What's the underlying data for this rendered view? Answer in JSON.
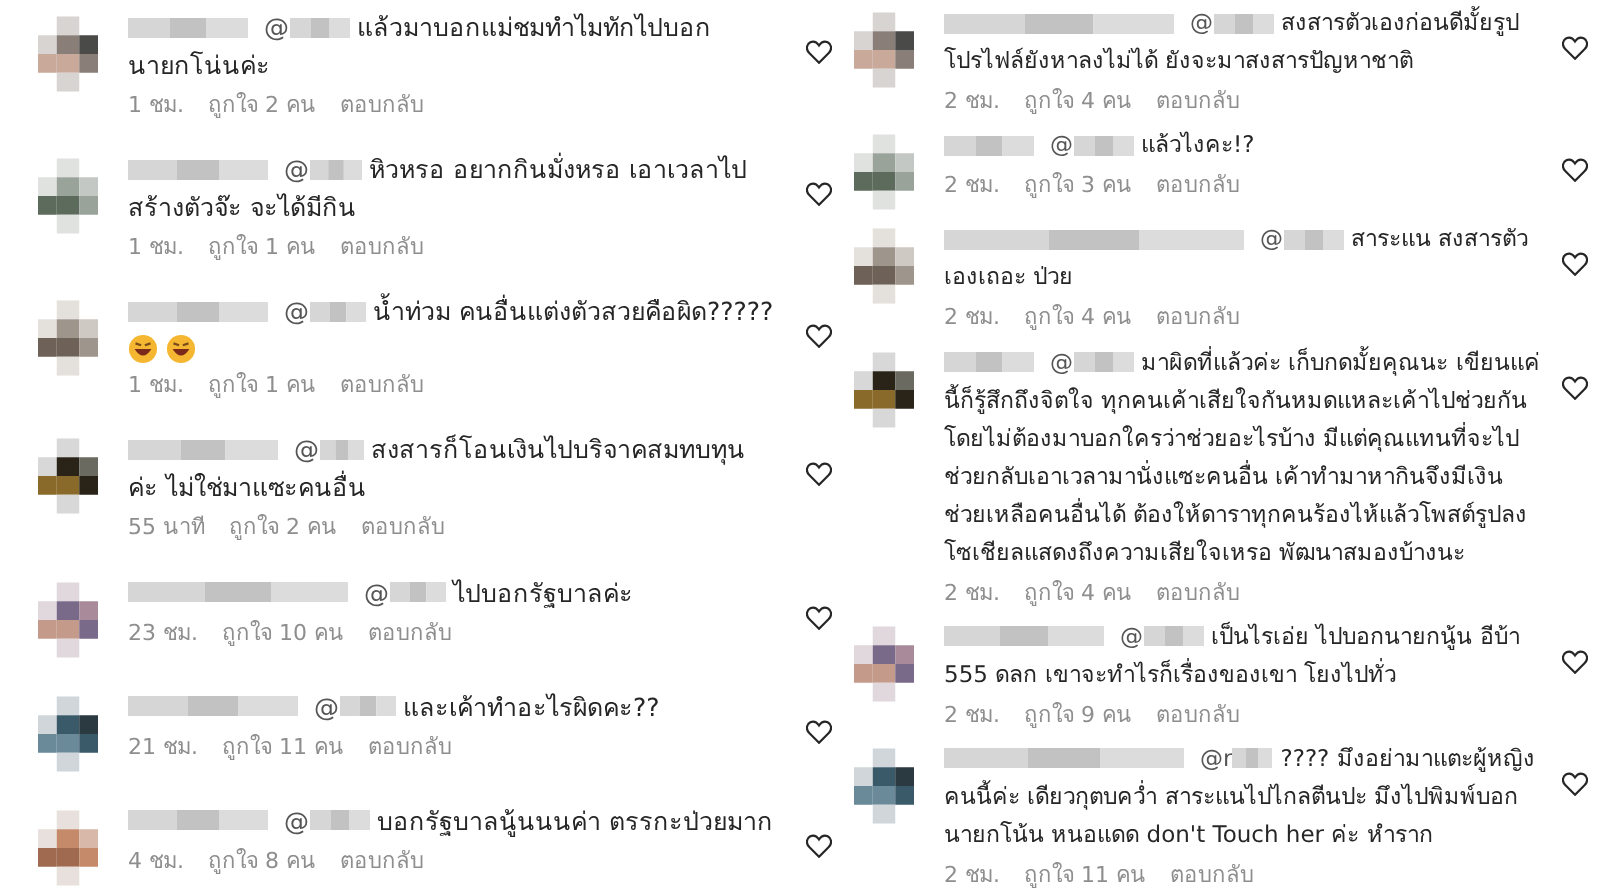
{
  "left_column": {
    "comments": [
      {
        "mention": "@",
        "lines": [
          "แล้วมาบอกแม่ชมทำไมทักไปบอก",
          "นายกโน่นค่ะ"
        ],
        "has_emojis": false,
        "time": "1 ชม.",
        "likes": "ถูกใจ 2 คน",
        "reply": "ตอบกลับ",
        "liked": false
      },
      {
        "mention": "@",
        "lines": [
          "หิวหรอ อยากกินมั่งหรอ เอาเวลาไป",
          "สร้างตัวจ๊ะ จะได้มีกิน"
        ],
        "has_emojis": false,
        "time": "1 ชม.",
        "likes": "ถูกใจ 1 คน",
        "reply": "ตอบกลับ",
        "liked": false
      },
      {
        "mention": "@",
        "lines": [
          "น้ำท่วม คนอื่นแต่งตัวสวยคือผิด?????"
        ],
        "has_emojis": true,
        "time": "1 ชม.",
        "likes": "ถูกใจ 1 คน",
        "reply": "ตอบกลับ",
        "liked": false
      },
      {
        "mention": "@",
        "lines": [
          "สงสารก็โอนเงินไปบริจาคสมทบทุน",
          "ค่ะ ไม่ใช่มาแซะคนอื่น"
        ],
        "has_emojis": false,
        "time": "55 นาที",
        "likes": "ถูกใจ 2 คน",
        "reply": "ตอบกลับ",
        "liked": false
      },
      {
        "mention": "@",
        "lines": [
          "ไปบอกรัฐบาลค่ะ"
        ],
        "has_emojis": false,
        "time": "23 ชม.",
        "likes": "ถูกใจ 10 คน",
        "reply": "ตอบกลับ",
        "liked": false
      },
      {
        "mention": "@",
        "lines": [
          "และเค้าทำอะไรผิดคะ??"
        ],
        "has_emojis": false,
        "time": "21 ชม.",
        "likes": "ถูกใจ 11 คน",
        "reply": "ตอบกลับ",
        "liked": false
      },
      {
        "mention": "@",
        "lines": [
          "บอกรัฐบาลนู้นนนค่า ตรรกะป่วยมาก"
        ],
        "has_emojis": false,
        "time": "4 ชม.",
        "likes": "ถูกใจ 8 คน",
        "reply": "ตอบกลับ",
        "liked": false
      }
    ]
  },
  "right_column": {
    "comments": [
      {
        "mention": "@",
        "lines": [
          "สงสารตัวเองก่อนดีมั้ยรูป",
          "โปรไฟล์ยังหาลงไม่ได้ ยังจะมาสงสารปัญหาชาติ"
        ],
        "has_emojis": false,
        "time": "2 ชม.",
        "likes": "ถูกใจ 4 คน",
        "reply": "ตอบกลับ",
        "liked": false
      },
      {
        "mention": "@",
        "lines": [
          "แล้วไงคะ!?"
        ],
        "has_emojis": false,
        "time": "2 ชม.",
        "likes": "ถูกใจ 3 คน",
        "reply": "ตอบกลับ",
        "liked": false
      },
      {
        "mention": "@",
        "lines": [
          "สาระแน สงสารตัว",
          "เองเถอะ ป่วย"
        ],
        "has_emojis": false,
        "time": "2 ชม.",
        "likes": "ถูกใจ 4 คน",
        "reply": "ตอบกลับ",
        "liked": false
      },
      {
        "mention": "@",
        "lines": [
          "มาผิดที่แล้วค่ะ เก็บกดมั้ยคุณนะ เขียนแค่",
          "นี้ก็รู้สึกถึงจิตใจ ทุกคนเค้าเสียใจกันหมดแหละเค้าไปช่วยกัน",
          "โดยไม่ต้องมาบอกใครว่าช่วยอะไรบ้าง มีแต่คุณแทนที่จะไป",
          "ช่วยกลับเอาเวลามานั่งแซะคนอื่น เค้าทำมาหากินจึงมีเงิน",
          "ช่วยเหลือคนอื่นได้ ต้องให้ดาราทุกคนร้องไห้แล้วโพสต์รูปลง",
          "โซเชียลแสดงถึงความเสียใจเหรอ พัฒนาสมองบ้างนะ"
        ],
        "has_emojis": false,
        "time": "2 ชม.",
        "likes": "ถูกใจ 4 คน",
        "reply": "ตอบกลับ",
        "liked": false
      },
      {
        "mention": "@",
        "lines": [
          "เป็นไรเอ่ย ไปบอกนายกนู้น อีบ้า",
          "555 ดลก เขาจะทำไรก็เรื่องของเขา โยงไปทั่ว"
        ],
        "has_emojis": false,
        "time": "2 ชม.",
        "likes": "ถูกใจ 9 คน",
        "reply": "ตอบกลับ",
        "liked": false
      },
      {
        "mention": "@r",
        "lines": [
          "???? มึงอย่ามาแตะผู้หญิง",
          "คนนี้ค่ะ เดียวกุตบคว่ำ สาระแนไปไกลตีนปะ มึงไปพิมพ์บอก",
          "นายกโน้น หนอแดด don't Touch her ค่ะ หำราก"
        ],
        "has_emojis": false,
        "time": "2 ชม.",
        "likes": "ถูกใจ 11 คน",
        "reply": "ตอบกลับ",
        "liked": false
      }
    ]
  }
}
